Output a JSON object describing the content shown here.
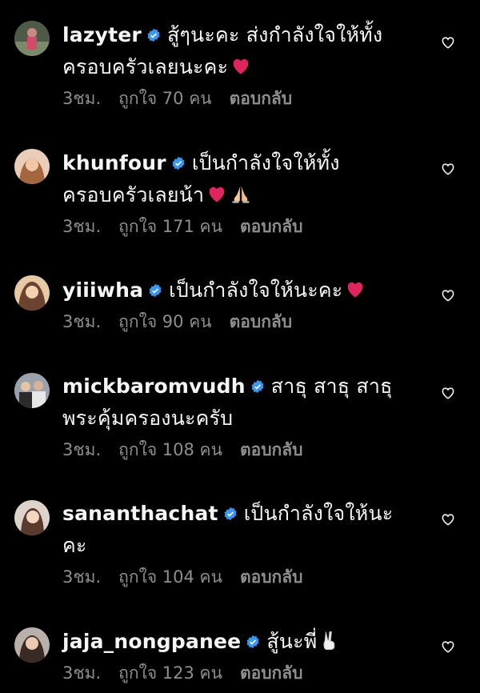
{
  "comments": [
    {
      "username": "lazyter",
      "text": "สู้ๆนะคะ ส่งกำลังใจให้ทั้งครอบครัวเลยนะคะ",
      "emoji": "red-heart",
      "time": "3ชม.",
      "likes": "ถูกใจ 70 คน",
      "reply": "ตอบกลับ",
      "avatar_color": "#5a6b4f"
    },
    {
      "username": "khunfour",
      "text": "เป็นกำลังใจให้ทั้งครอบครัวเลยน้า",
      "emoji": "red-heart praying-hands",
      "time": "3ชม.",
      "likes": "ถูกใจ 171 คน",
      "reply": "ตอบกลับ",
      "avatar_color": "#c98f6e"
    },
    {
      "username": "yiiiwha",
      "text": "เป็นกำลังใจให้นะคะ",
      "emoji": "red-heart",
      "time": "3ชม.",
      "likes": "ถูกใจ 90 คน",
      "reply": "ตอบกลับ",
      "avatar_color": "#d8b48f"
    },
    {
      "username": "mickbaromvudh",
      "text": "สาธุ สาธุ สาธุ พระคุ้มครองนะครับ",
      "emoji": "",
      "time": "3ชม.",
      "likes": "ถูกใจ 108 คน",
      "reply": "ตอบกลับ",
      "avatar_color": "#8a8a8a"
    },
    {
      "username": "sananthachat",
      "text": "เป็นกำลังใจให้นะคะ",
      "emoji": "",
      "time": "3ชม.",
      "likes": "ถูกใจ 104 คน",
      "reply": "ตอบกลับ",
      "avatar_color": "#b89a86"
    },
    {
      "username": "jaja_nongpanee",
      "text": "สู้นะพี่",
      "emoji": "victory-hand",
      "time": "3ชม.",
      "likes": "ถูกใจ 123 คน",
      "reply": "ตอบกลับ",
      "avatar_color": "#7b6a63"
    }
  ],
  "colors": {
    "background": "#000000",
    "text": "#f5f5f5",
    "meta": "#8e8e8e",
    "verified": "#3897f0",
    "heart": "#e0245e"
  }
}
